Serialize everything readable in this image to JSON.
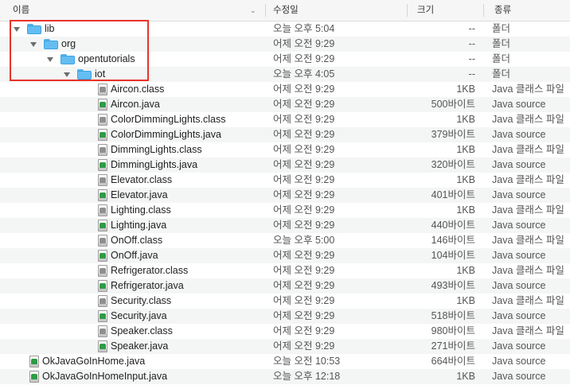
{
  "columns": {
    "name": "이름",
    "date": "수정일",
    "size": "크기",
    "kind": "종류"
  },
  "rows": [
    {
      "name": "lib",
      "date": "오늘 오후 5:04",
      "size": "--",
      "kind": "폴더",
      "type": "folder",
      "depth": 0,
      "expanded": true
    },
    {
      "name": "org",
      "date": "어제 오전 9:29",
      "size": "--",
      "kind": "폴더",
      "type": "folder",
      "depth": 1,
      "expanded": true
    },
    {
      "name": "opentutorials",
      "date": "어제 오전 9:29",
      "size": "--",
      "kind": "폴더",
      "type": "folder",
      "depth": 2,
      "expanded": true
    },
    {
      "name": "iot",
      "date": "오늘 오후 4:05",
      "size": "--",
      "kind": "폴더",
      "type": "folder",
      "depth": 3,
      "expanded": true
    },
    {
      "name": "Aircon.class",
      "date": "어제 오전 9:29",
      "size": "1KB",
      "kind": "Java 클래스 파일",
      "type": "class",
      "depth": 4
    },
    {
      "name": "Aircon.java",
      "date": "어제 오전 9:29",
      "size": "500바이트",
      "kind": "Java source",
      "type": "java",
      "depth": 4
    },
    {
      "name": "ColorDimmingLights.class",
      "date": "어제 오전 9:29",
      "size": "1KB",
      "kind": "Java 클래스 파일",
      "type": "class",
      "depth": 4
    },
    {
      "name": "ColorDimmingLights.java",
      "date": "어제 오전 9:29",
      "size": "379바이트",
      "kind": "Java source",
      "type": "java",
      "depth": 4
    },
    {
      "name": "DimmingLights.class",
      "date": "어제 오전 9:29",
      "size": "1KB",
      "kind": "Java 클래스 파일",
      "type": "class",
      "depth": 4
    },
    {
      "name": "DimmingLights.java",
      "date": "어제 오전 9:29",
      "size": "320바이트",
      "kind": "Java source",
      "type": "java",
      "depth": 4
    },
    {
      "name": "Elevator.class",
      "date": "어제 오전 9:29",
      "size": "1KB",
      "kind": "Java 클래스 파일",
      "type": "class",
      "depth": 4
    },
    {
      "name": "Elevator.java",
      "date": "어제 오전 9:29",
      "size": "401바이트",
      "kind": "Java source",
      "type": "java",
      "depth": 4
    },
    {
      "name": "Lighting.class",
      "date": "어제 오전 9:29",
      "size": "1KB",
      "kind": "Java 클래스 파일",
      "type": "class",
      "depth": 4
    },
    {
      "name": "Lighting.java",
      "date": "어제 오전 9:29",
      "size": "440바이트",
      "kind": "Java source",
      "type": "java",
      "depth": 4
    },
    {
      "name": "OnOff.class",
      "date": "오늘 오후 5:00",
      "size": "146바이트",
      "kind": "Java 클래스 파일",
      "type": "class",
      "depth": 4
    },
    {
      "name": "OnOff.java",
      "date": "어제 오전 9:29",
      "size": "104바이트",
      "kind": "Java source",
      "type": "java",
      "depth": 4
    },
    {
      "name": "Refrigerator.class",
      "date": "어제 오전 9:29",
      "size": "1KB",
      "kind": "Java 클래스 파일",
      "type": "class",
      "depth": 4
    },
    {
      "name": "Refrigerator.java",
      "date": "어제 오전 9:29",
      "size": "493바이트",
      "kind": "Java source",
      "type": "java",
      "depth": 4
    },
    {
      "name": "Security.class",
      "date": "어제 오전 9:29",
      "size": "1KB",
      "kind": "Java 클래스 파일",
      "type": "class",
      "depth": 4
    },
    {
      "name": "Security.java",
      "date": "어제 오전 9:29",
      "size": "518바이트",
      "kind": "Java source",
      "type": "java",
      "depth": 4
    },
    {
      "name": "Speaker.class",
      "date": "어제 오전 9:29",
      "size": "980바이트",
      "kind": "Java 클래스 파일",
      "type": "class",
      "depth": 4
    },
    {
      "name": "Speaker.java",
      "date": "어제 오전 9:29",
      "size": "271바이트",
      "kind": "Java source",
      "type": "java",
      "depth": 4
    },
    {
      "name": "OkJavaGoInHome.java",
      "date": "오늘 오전 10:53",
      "size": "664바이트",
      "kind": "Java source",
      "type": "java",
      "depth": 0
    },
    {
      "name": "OkJavaGoInHomeInput.java",
      "date": "오늘 오후 12:18",
      "size": "1KB",
      "kind": "Java source",
      "type": "java",
      "depth": 0
    }
  ],
  "colors": {
    "highlight": "#e8332a",
    "folder": "#64bdf2",
    "java_icon": "#2e9c45"
  }
}
